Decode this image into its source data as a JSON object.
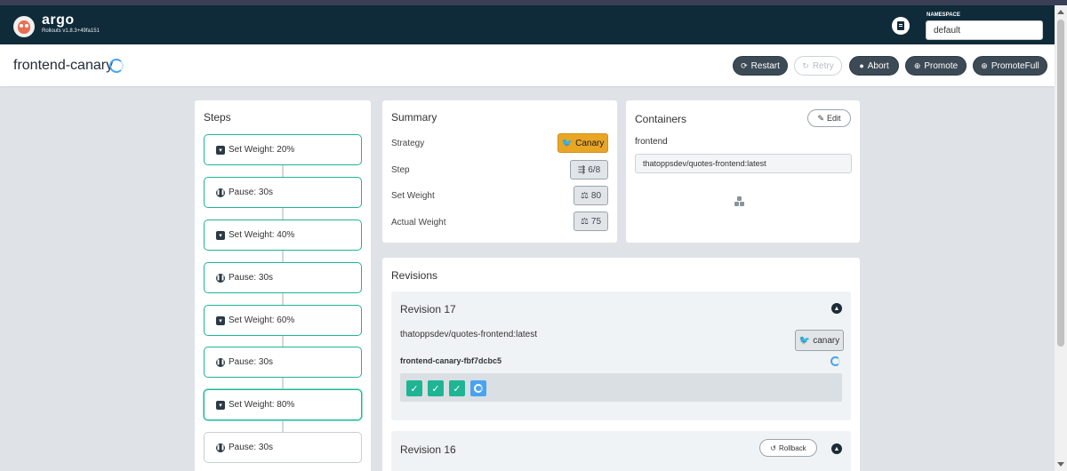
{
  "app": {
    "brand": "argo",
    "version": "Rollouts v1.8.3+49fa151",
    "namespace_label": "NAMESPACE",
    "namespace_value": "default"
  },
  "header": {
    "title": "frontend-canary",
    "buttons": {
      "restart": "Restart",
      "retry": "Retry",
      "abort": "Abort",
      "promote": "Promote",
      "promote_full": "PromoteFull"
    }
  },
  "steps": {
    "title": "Steps",
    "items": [
      {
        "label": "Set Weight: 20%",
        "type": "weight",
        "state": "done"
      },
      {
        "label": "Pause: 30s",
        "type": "pause",
        "state": "done"
      },
      {
        "label": "Set Weight: 40%",
        "type": "weight",
        "state": "done"
      },
      {
        "label": "Pause: 30s",
        "type": "pause",
        "state": "done"
      },
      {
        "label": "Set Weight: 60%",
        "type": "weight",
        "state": "done"
      },
      {
        "label": "Pause: 30s",
        "type": "pause",
        "state": "done"
      },
      {
        "label": "Set Weight: 80%",
        "type": "weight",
        "state": "current"
      },
      {
        "label": "Pause: 30s",
        "type": "pause",
        "state": "pending"
      }
    ]
  },
  "summary": {
    "title": "Summary",
    "rows": [
      {
        "label": "Strategy",
        "value": "Canary"
      },
      {
        "label": "Step",
        "value": "6/8"
      },
      {
        "label": "Set Weight",
        "value": "80"
      },
      {
        "label": "Actual Weight",
        "value": "75"
      }
    ]
  },
  "containers": {
    "title": "Containers",
    "edit_label": "Edit",
    "name": "frontend",
    "image": "thatoppsdev/quotes-frontend:latest"
  },
  "revisions": {
    "title": "Revisions",
    "items": [
      {
        "title": "Revision 17",
        "image": "thatoppsdev/quotes-frontend:latest",
        "badge": "canary",
        "replicaset": "frontend-canary-fbf7dcbc5"
      },
      {
        "title": "Revision 16",
        "rollback_label": "Rollback"
      }
    ]
  },
  "colors": {
    "nav_bg": "#0f2b3a",
    "step_border": "#1fb494",
    "canary_badge": "#e9a524",
    "progress_blue": "#4aa3f0"
  },
  "icons": [
    "argo-logo-icon",
    "docs-icon",
    "spinner-icon",
    "restart-icon",
    "retry-icon",
    "abort-icon",
    "promote-icon",
    "promote-full-icon",
    "weight-icon",
    "pause-icon",
    "canary-bird-icon",
    "steps-icon",
    "scale-icon",
    "edit-icon",
    "container-icon",
    "chevron-up-icon",
    "rollback-icon",
    "check-icon"
  ]
}
